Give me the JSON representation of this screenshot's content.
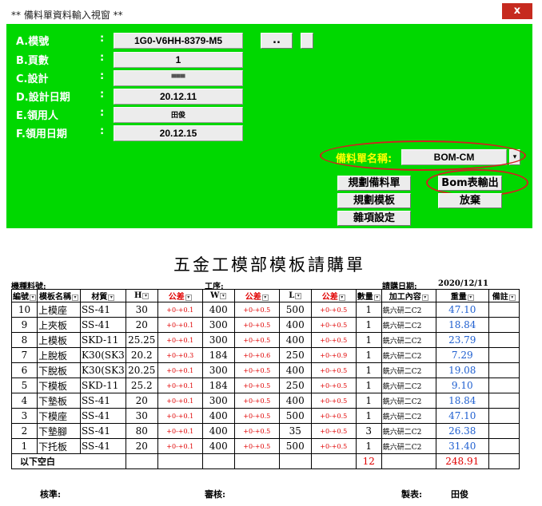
{
  "window": {
    "title": "**  備料單資料輸入視窗 **",
    "close_label": "x"
  },
  "form": {
    "fields": [
      {
        "label": "A.模號",
        "value": "1G0-V6HH-8379-M5"
      },
      {
        "label": "B.頁數",
        "value": "1"
      },
      {
        "label": "C.設計",
        "value": "▀▀▀"
      },
      {
        "label": "D.設計日期",
        "value": "20.12.11"
      },
      {
        "label": "E.領用人",
        "value": "田俊"
      },
      {
        "label": "F.領用日期",
        "value": "20.12.15"
      }
    ],
    "colon": ":",
    "browse_button": "..",
    "bom_name_label": "備料單名稱:",
    "bom_name_value": "BOM-CM",
    "buttons": {
      "plan_material": "規劃備料單",
      "bom_export": "Bom表輸出",
      "plan_template": "規劃模板",
      "cancel": "放棄",
      "misc_settings": "雜項設定"
    }
  },
  "document": {
    "title": "五金工模部模板請購單",
    "machine_label": "機種料號:",
    "process_label": "工序:",
    "date_label": "請購日期:",
    "date_value": "2020/12/11",
    "columns": [
      "編號",
      "模板名稱",
      "材質",
      "H",
      "公差",
      "W",
      "公差",
      "L",
      "公差",
      "數量",
      "加工內容",
      "重量",
      "備註"
    ],
    "rows": [
      [
        "10",
        "上模座",
        "SS-41",
        "30",
        "+0-+0.1",
        "400",
        "+0-+0.5",
        "500",
        "+0-+0.5",
        "1",
        "銑六研二C2",
        "47.10",
        ""
      ],
      [
        "9",
        "上夾板",
        "SS-41",
        "20",
        "+0-+0.1",
        "300",
        "+0-+0.5",
        "400",
        "+0-+0.5",
        "1",
        "銑六研二C2",
        "18.84",
        ""
      ],
      [
        "8",
        "上模板",
        "SKD-11",
        "25.25",
        "+0-+0.1",
        "300",
        "+0-+0.5",
        "400",
        "+0-+0.5",
        "1",
        "銑六研二C2",
        "23.79",
        ""
      ],
      [
        "7",
        "上脫板",
        "K30(SK3",
        "20.2",
        "+0-+0.3",
        "184",
        "+0-+0.6",
        "250",
        "+0-+0.9",
        "1",
        "銑六研二C2",
        "7.29",
        ""
      ],
      [
        "6",
        "下脫板",
        "K30(SK3",
        "20.25",
        "+0-+0.1",
        "300",
        "+0-+0.5",
        "400",
        "+0-+0.5",
        "1",
        "銑六研二C2",
        "19.08",
        ""
      ],
      [
        "5",
        "下模板",
        "SKD-11",
        "25.2",
        "+0-+0.1",
        "184",
        "+0-+0.5",
        "250",
        "+0-+0.5",
        "1",
        "銑六研二C2",
        "9.10",
        ""
      ],
      [
        "4",
        "下墊板",
        "SS-41",
        "20",
        "+0-+0.1",
        "300",
        "+0-+0.5",
        "400",
        "+0-+0.5",
        "1",
        "銑六研二C2",
        "18.84",
        ""
      ],
      [
        "3",
        "下模座",
        "SS-41",
        "30",
        "+0-+0.1",
        "400",
        "+0-+0.5",
        "500",
        "+0-+0.5",
        "1",
        "銑六研二C2",
        "47.10",
        ""
      ],
      [
        "2",
        "下墊腳",
        "SS-41",
        "80",
        "+0-+0.1",
        "400",
        "+0-+0.5",
        "35",
        "+0-+0.5",
        "3",
        "銑六研二C2",
        "26.38",
        ""
      ],
      [
        "1",
        "下托板",
        "SS-41",
        "20",
        "+0-+0.1",
        "400",
        "+0-+0.5",
        "500",
        "+0-+0.5",
        "1",
        "銑六研二C2",
        "31.40",
        ""
      ]
    ],
    "blank_note": "以下空白",
    "total_qty": "12",
    "total_weight": "248.91",
    "footer": {
      "approve_label": "核準:",
      "review_label": "審核:",
      "prepared_label": "製表:",
      "prepared_value": "田俊"
    }
  },
  "colors": {
    "dialog_bg": "#00d800",
    "label_text": "#ffffff",
    "bom_name_label": "#ffff00",
    "highlight_ellipse": "#d42020",
    "tolerance_text": "#e00000",
    "weight_text": "#2060d0"
  }
}
